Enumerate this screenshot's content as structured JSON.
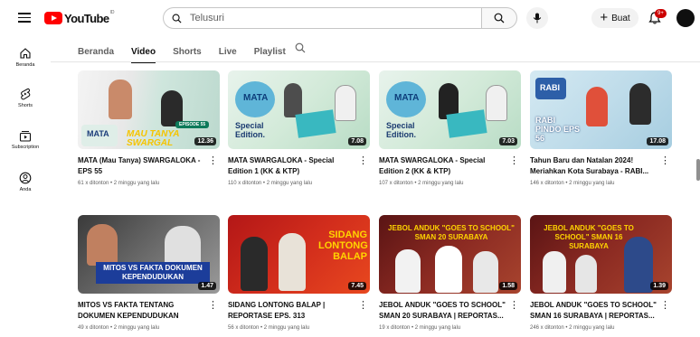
{
  "header": {
    "logo_text": "YouTube",
    "logo_country": "ID",
    "search_placeholder": "Telusuri",
    "create_label": "Buat",
    "notification_count": "9+"
  },
  "sidebar": {
    "items": [
      {
        "label": "Beranda",
        "icon": "home-icon"
      },
      {
        "label": "Shorts",
        "icon": "shorts-icon"
      },
      {
        "label": "Subscription",
        "icon": "subscriptions-icon"
      },
      {
        "label": "Anda",
        "icon": "you-icon"
      }
    ]
  },
  "tabs": [
    {
      "label": "Beranda",
      "active": false
    },
    {
      "label": "Video",
      "active": true
    },
    {
      "label": "Shorts",
      "active": false
    },
    {
      "label": "Live",
      "active": false
    },
    {
      "label": "Playlist",
      "active": false
    }
  ],
  "videos": [
    {
      "title_line1": "MATA (Mau Tanya) SWARGALOKA -",
      "title_line2": "EPS 55",
      "views": "61 x ditonton",
      "age": "2 minggu yang lalu",
      "duration": "12.36",
      "overlay": "MAU TANYA SWARGAL",
      "badge": "EPISODE 55",
      "logo": "MATA"
    },
    {
      "title_line1": "MATA SWARGALOKA - Special",
      "title_line2": "Edition 1 (KK & KTP)",
      "views": "110 x ditonton",
      "age": "2 minggu yang lalu",
      "duration": "7.08",
      "overlay": "Special Edition.",
      "badge": "",
      "logo": "MATA"
    },
    {
      "title_line1": "MATA SWARGALOKA - Special",
      "title_line2": "Edition 2 (KK & KTP)",
      "views": "107 x ditonton",
      "age": "2 minggu yang lalu",
      "duration": "7.03",
      "overlay": "Special Edition.",
      "badge": "",
      "logo": "MATA"
    },
    {
      "title_line1": "Tahun Baru dan Natalan 2024!",
      "title_line2": "Meriahkan Kota Surabaya - RABI...",
      "views": "146 x ditonton",
      "age": "2 minggu yang lalu",
      "duration": "17.08",
      "overlay": "RABI PINDO EPS 56",
      "badge": "",
      "logo": "RABI"
    },
    {
      "title_line1": "MITOS VS FAKTA TENTANG",
      "title_line2": "DOKUMEN KEPENDUDUKAN",
      "views": "49 x ditonton",
      "age": "2 minggu yang lalu",
      "duration": "1.47",
      "overlay": "MITOS VS FAKTA DOKUMEN KEPENDUDUKAN",
      "badge": "",
      "logo": ""
    },
    {
      "title_line1": "SIDANG LONTONG BALAP |",
      "title_line2": "REPORTASE EPS. 313",
      "views": "56 x ditonton",
      "age": "2 minggu yang lalu",
      "duration": "7.45",
      "overlay": "SIDANG LONTONG BALAP",
      "badge": "",
      "logo": ""
    },
    {
      "title_line1": "JEBOL ANDUK \"GOES TO SCHOOL\"",
      "title_line2": "SMAN 20 SURABAYA | REPORTAS...",
      "views": "19 x ditonton",
      "age": "2 minggu yang lalu",
      "duration": "1.58",
      "overlay": "JEBOL ANDUK \"GOES TO SCHOOL\" SMAN 20 SURABAYA",
      "badge": "",
      "logo": ""
    },
    {
      "title_line1": "JEBOL ANDUK \"GOES TO SCHOOL\"",
      "title_line2": "SMAN 16 SURABAYA | REPORTAS...",
      "views": "246 x ditonton",
      "age": "2 minggu yang lalu",
      "duration": "1.39",
      "overlay": "JEBOL ANDUK \"GOES TO SCHOOL\" SMAN 16 SURABAYA",
      "badge": "",
      "logo": ""
    }
  ],
  "colors": {
    "brand_red": "#ff0000",
    "mata_green": "#6fc3a8",
    "badge_red": "#cc0000"
  }
}
